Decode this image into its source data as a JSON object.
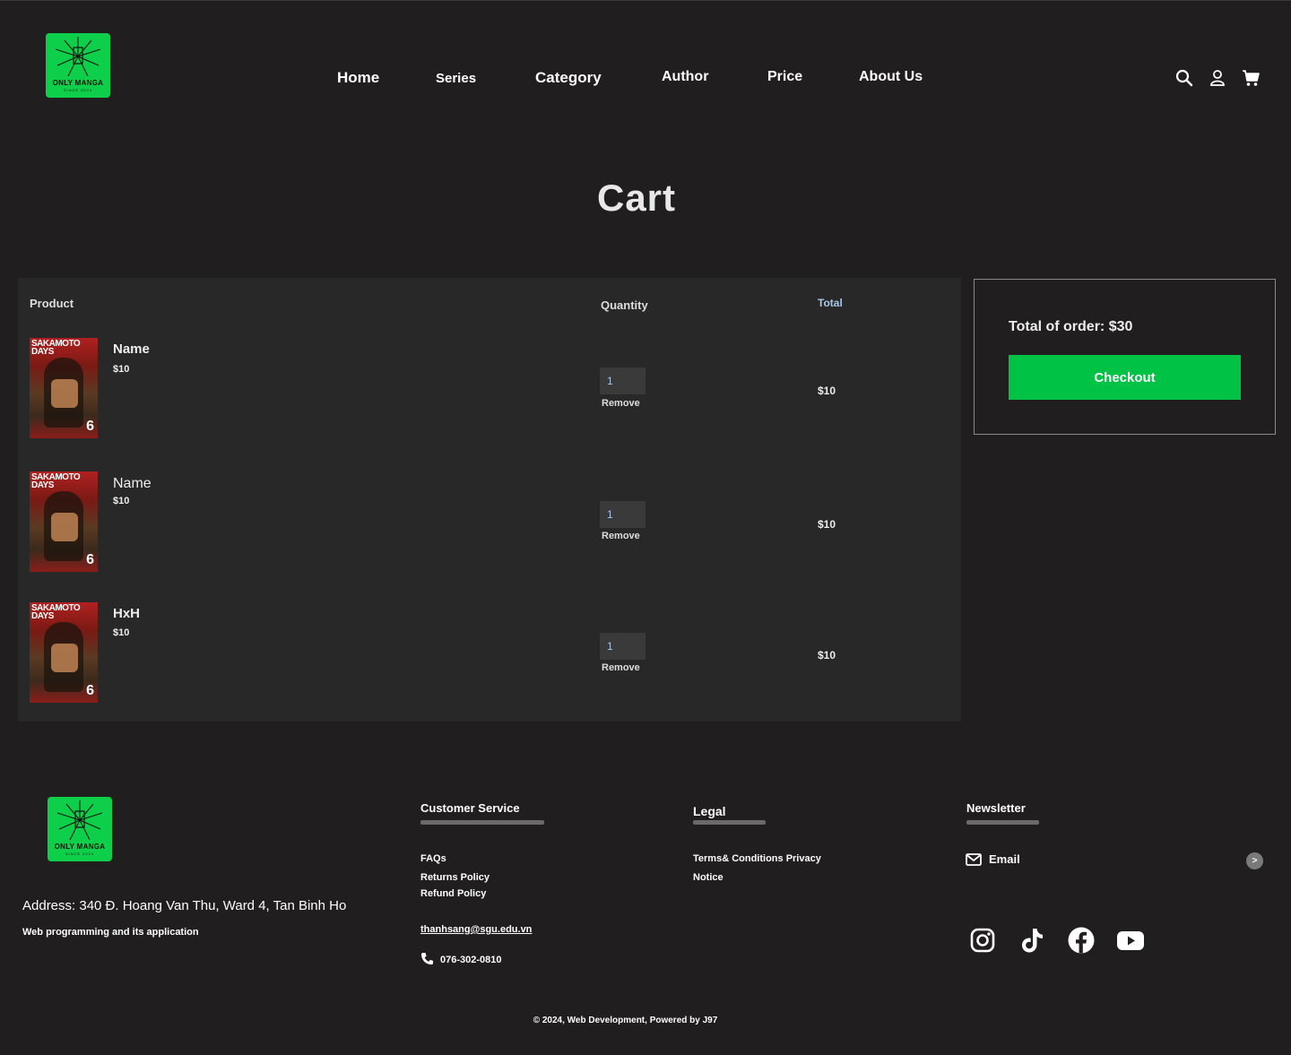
{
  "brand": {
    "name": "ONLY MANGA",
    "since": "SINCE 2024"
  },
  "nav": [
    "Home",
    "Series",
    "Category",
    "Author",
    "Price",
    "About Us"
  ],
  "header_icons": [
    "search-icon",
    "user-icon",
    "cart-icon"
  ],
  "page_title": "Cart",
  "cart": {
    "headers": {
      "product": "Product",
      "quantity": "Quantity",
      "total": "Total"
    },
    "items": [
      {
        "name": "Name",
        "price": "$10",
        "quantity": "1",
        "total": "$10",
        "remove": "Remove",
        "cover_title": "SAKAMOTO DAYS",
        "cover_volume": "6"
      },
      {
        "name": "Name",
        "price": "$10",
        "quantity": "1",
        "total": "$10",
        "remove": "Remove",
        "cover_title": "SAKAMOTO DAYS",
        "cover_volume": "6"
      },
      {
        "name": "HxH",
        "price": "$10",
        "quantity": "1",
        "total": "$10",
        "remove": "Remove",
        "cover_title": "SAKAMOTO DAYS",
        "cover_volume": "6"
      }
    ]
  },
  "summary": {
    "total_label": "Total of order: $30",
    "checkout": "Checkout"
  },
  "footer": {
    "address": "Address: 340 Đ. Hoang Van Thu, Ward 4, Tan Binh Ho",
    "tagline": "Web programming and its application",
    "customer_service": {
      "title": "Customer Service",
      "links": [
        "FAQs",
        "Returns Policy",
        "Refund Policy"
      ],
      "email": "thanhsang@sgu.edu.vn",
      "phone": "076-302-0810"
    },
    "legal": {
      "title": "Legal",
      "line1": "Terms& Conditions Privacy",
      "line2": "Notice"
    },
    "newsletter": {
      "title": "Newsletter",
      "email_label": "Email",
      "submit": ">"
    },
    "social": [
      "instagram-icon",
      "tiktok-icon",
      "facebook-icon",
      "youtube-icon"
    ],
    "copyright": "© 2024, Web Development, Powered by J97"
  },
  "colors": {
    "background": "#201e1e",
    "panel": "#282828",
    "accent": "#00c244",
    "logo": "#0ecf4a"
  }
}
